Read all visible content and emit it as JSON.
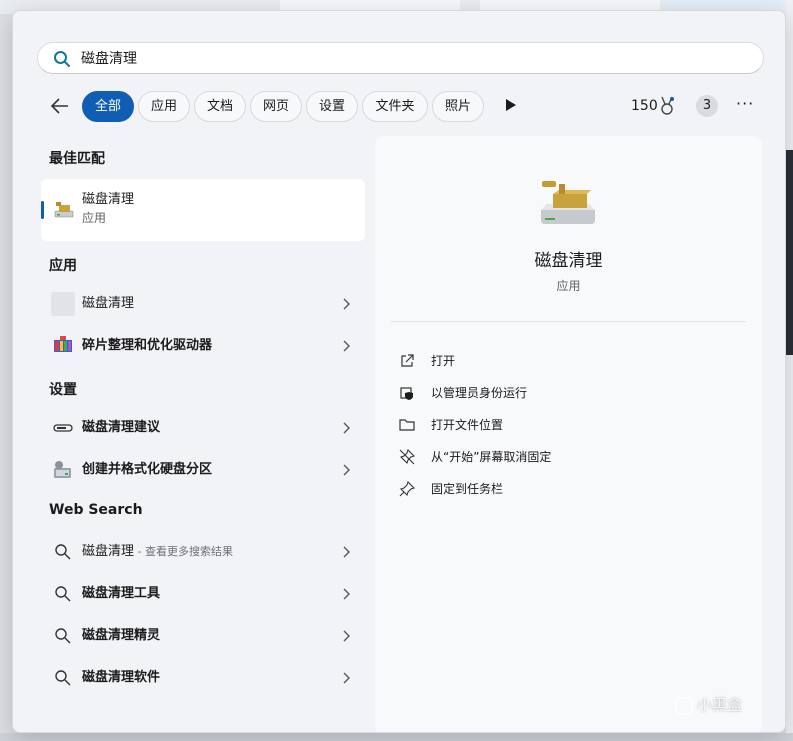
{
  "search": {
    "value": "磁盘清理"
  },
  "filters": {
    "tabs": [
      "全部",
      "应用",
      "文档",
      "网页",
      "设置",
      "文件夹",
      "照片"
    ],
    "active": "全部"
  },
  "account": {
    "points": "150",
    "badge": "3"
  },
  "best_match": {
    "heading": "最佳匹配",
    "name": "磁盘清理",
    "type": "应用",
    "icon": "disk-cleanup-icon"
  },
  "apps": {
    "heading": "应用",
    "items": [
      {
        "label": "磁盘清理",
        "icon": "blank-app-icon"
      },
      {
        "label": "碎片整理和优化驱动器",
        "icon": "defrag-icon"
      }
    ]
  },
  "settings": {
    "heading": "设置",
    "items": [
      {
        "label": "磁盘清理建议",
        "icon": "storage-bar-icon"
      },
      {
        "label": "创建并格式化硬盘分区",
        "icon": "disk-management-icon"
      }
    ]
  },
  "web_search": {
    "heading": "Web Search",
    "items": [
      {
        "label": "磁盘清理",
        "hint": " - 查看更多搜索结果",
        "icon": "search-icon"
      },
      {
        "label": "磁盘清理工具",
        "icon": "search-icon"
      },
      {
        "label": "磁盘清理精灵",
        "icon": "search-icon"
      },
      {
        "label": "磁盘清理软件",
        "icon": "search-icon"
      }
    ]
  },
  "detail": {
    "title": "磁盘清理",
    "subtitle": "应用",
    "actions": [
      {
        "label": "打开",
        "icon": "open-external-icon"
      },
      {
        "label": "以管理员身份运行",
        "icon": "shield-icon"
      },
      {
        "label": "打开文件位置",
        "icon": "folder-icon"
      },
      {
        "label": "从“开始”屏幕取消固定",
        "icon": "unpin-icon"
      },
      {
        "label": "固定到任务栏",
        "icon": "pin-icon"
      }
    ]
  },
  "watermark": "小黑盒",
  "colors": {
    "accent": "#0f5eb3",
    "panel": "#f1f3f6"
  }
}
